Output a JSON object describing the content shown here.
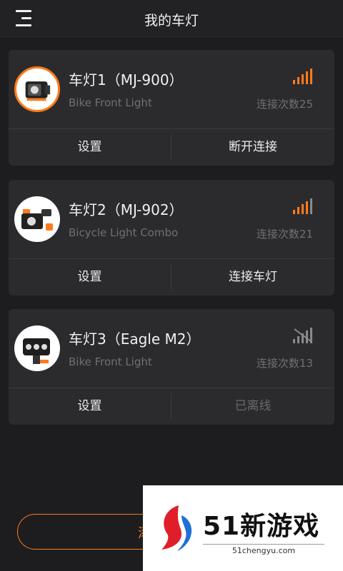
{
  "header": {
    "title": "我的车灯"
  },
  "lights": [
    {
      "name": "车灯1（MJ-900）",
      "model": "Bike Front Light",
      "count": "连接次数25",
      "signal": "strong",
      "left_action": "设置",
      "right_action": "断开连接",
      "right_enabled": true
    },
    {
      "name": "车灯2（MJ-902）",
      "model": "Bicycle Light Combo",
      "count": "连接次数21",
      "signal": "strong",
      "left_action": "设置",
      "right_action": "连接车灯",
      "right_enabled": true
    },
    {
      "name": "车灯3（Eagle M2）",
      "model": "Bike Front Light",
      "count": "连接次数13",
      "signal": "off",
      "left_action": "设置",
      "right_action": "已离线",
      "right_enabled": false
    }
  ],
  "bottom": {
    "add_button_visible_text": "添"
  },
  "watermark": {
    "brand": "51新游戏",
    "url": "51chengyu.com"
  },
  "colors": {
    "accent": "#ff7a1a",
    "background": "#1d1d1f",
    "card": "#2b2b2d"
  }
}
